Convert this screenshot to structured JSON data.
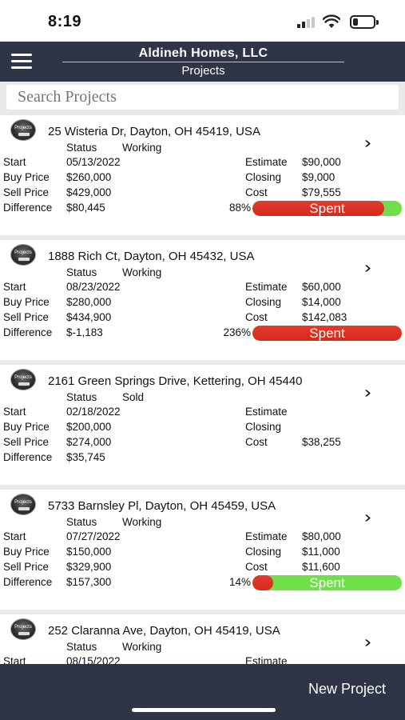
{
  "status_bar": {
    "time": "8:19"
  },
  "header": {
    "company": "Aldineh Homes, LLC",
    "page_title": "Projects"
  },
  "search": {
    "placeholder": "Search Projects"
  },
  "labels": {
    "status": "Status",
    "start": "Start",
    "buy_price": "Buy Price",
    "sell_price": "Sell Price",
    "difference": "Difference",
    "estimate": "Estimate",
    "closing": "Closing",
    "cost": "Cost",
    "spent": "Spent"
  },
  "projects": [
    {
      "logo_text": "Projects",
      "address": "25 Wisteria Dr, Dayton, OH 45419, USA",
      "status": "Working",
      "start": "05/13/2022",
      "buy_price": "$260,000",
      "sell_price": "$429,000",
      "difference": "$80,445",
      "estimate": "$90,000",
      "closing": "$9,000",
      "cost": "$79,555",
      "spent_percent": "88%",
      "spent_fraction": 0.88
    },
    {
      "logo_text": "Projects",
      "address": "1888 Rich Ct, Dayton, OH 45432, USA",
      "status": "Working",
      "start": "08/23/2022",
      "buy_price": "$280,000",
      "sell_price": "$434,900",
      "difference": "$-1,183",
      "estimate": "$60,000",
      "closing": "$14,000",
      "cost": "$142,083",
      "spent_percent": "236%",
      "spent_fraction": 1.0
    },
    {
      "logo_text": "Projects",
      "address": "2161 Green Springs Drive, Kettering, OH 45440",
      "status": "Sold",
      "start": "02/18/2022",
      "buy_price": "$200,000",
      "sell_price": "$274,000",
      "difference": "$35,745",
      "estimate": "",
      "closing": "",
      "cost": "$38,255",
      "spent_percent": "",
      "spent_fraction": null
    },
    {
      "logo_text": "Projects",
      "address": "5733 Barnsley Pl, Dayton, OH 45459, USA",
      "status": "Working",
      "start": "07/27/2022",
      "buy_price": "$150,000",
      "sell_price": "$329,900",
      "difference": "$157,300",
      "estimate": "$80,000",
      "closing": "$11,000",
      "cost": "$11,600",
      "spent_percent": "14%",
      "spent_fraction": 0.14
    },
    {
      "logo_text": "Projects",
      "address": "252 Claranna Ave, Dayton, OH 45419, USA",
      "status": "Working",
      "start": "08/15/2022",
      "buy_price": "",
      "sell_price": "",
      "difference": "",
      "estimate": "",
      "closing": "",
      "cost": "",
      "spent_percent": "",
      "spent_fraction": null
    }
  ],
  "footer": {
    "new_project_label": "New Project"
  },
  "colors": {
    "navbar": "#2f3447",
    "spent_red": "#d9301f",
    "remaining_green": "#6fe04a",
    "list_bg": "#e9e9eb"
  }
}
